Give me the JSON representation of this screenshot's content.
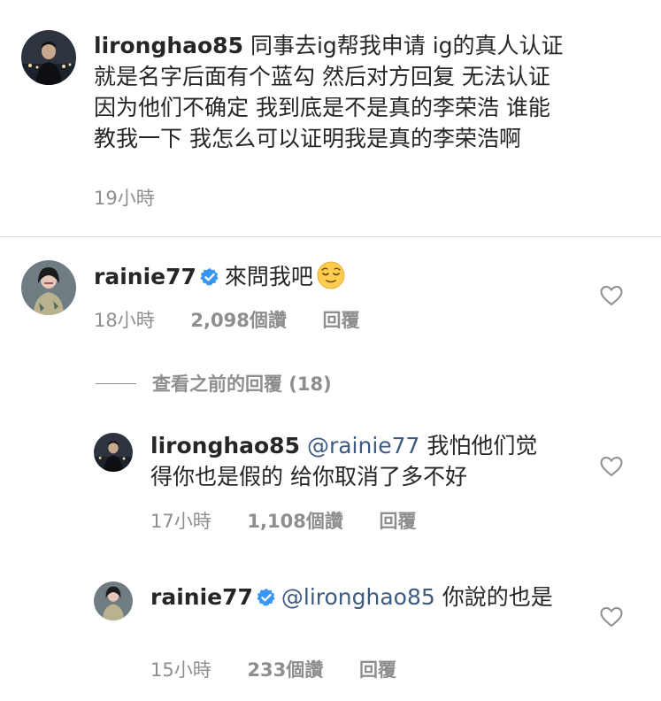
{
  "comments": [
    {
      "username": "lironghao85",
      "text": "同事去ig帮我申请 ig的真人认证 就是名字后面有个蓝勾 然后对方回复 无法认证 因为他们不确定 我到底是不是真的李荣浩 谁能教我一下 我怎么可以证明我是真的李荣浩啊",
      "time": "19小時"
    },
    {
      "username": "rainie77",
      "verified": true,
      "text": "來問我吧",
      "emoji": "relieved-face",
      "time": "18小時",
      "likes": "2,098個讚",
      "reply": "回覆"
    }
  ],
  "view_previous": "查看之前的回覆 (18)",
  "replies": [
    {
      "username": "lironghao85",
      "mention": "@rainie77",
      "text": "我怕他们觉得你也是假的 给你取消了多不好",
      "time": "17小時",
      "likes": "1,108個讚",
      "reply": "回覆"
    },
    {
      "username": "rainie77",
      "verified": true,
      "mention": "@lironghao85",
      "text": "你說的也是",
      "time": "15小時",
      "likes": "233個讚",
      "reply": "回覆"
    }
  ],
  "colors": {
    "text": "#262626",
    "meta": "#8e8e8e",
    "mention": "#3d5a80",
    "verified": "#3897f0",
    "divider": "#dbdbdb"
  }
}
